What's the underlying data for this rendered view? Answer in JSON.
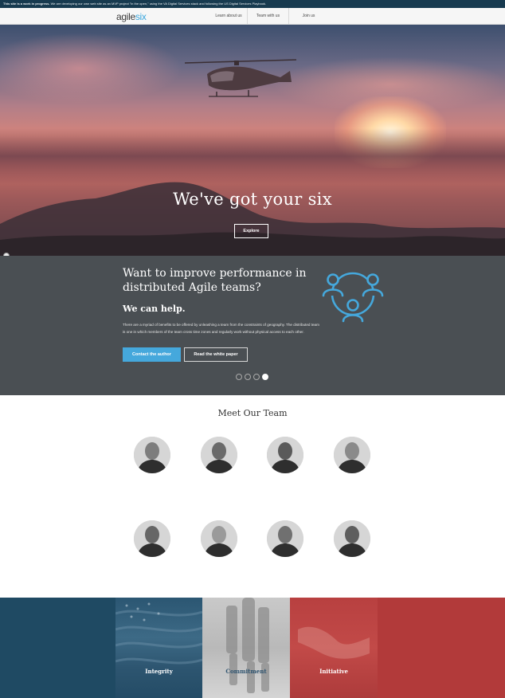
{
  "banner": {
    "bold": "This site is a work in progress.",
    "text": "We are developing our own web site as an MVP project \"in the open,\" using the VA Digital Services stack and following the US Digital Services Playbook."
  },
  "header": {
    "logo_part1": "agile",
    "logo_part2": "six",
    "nav": [
      "Learn about us",
      "Team with us",
      "Join us"
    ]
  },
  "hero": {
    "title": "We've got your six",
    "button": "Explore"
  },
  "promo": {
    "title": "Want to improve performance in distributed Agile teams?",
    "subtitle": "We can help.",
    "body": "There are a myriad of benefits to be offered by unleashing a team from the constraints of geography. The distributed team is one in which members of the team cross time zones and regularly work without physical access to each other.",
    "primary_button": "Contact the author",
    "secondary_button": "Read the white paper",
    "slides_total": 4,
    "slide_active": 4
  },
  "team": {
    "title": "Meet Our Team"
  },
  "values": {
    "items": [
      "Integrity",
      "Commitment",
      "Initiative"
    ]
  },
  "colors": {
    "accent": "#45a8dc",
    "promo_bg": "#4a4f53",
    "navy": "#1f4a63",
    "red": "#b23a3a"
  }
}
